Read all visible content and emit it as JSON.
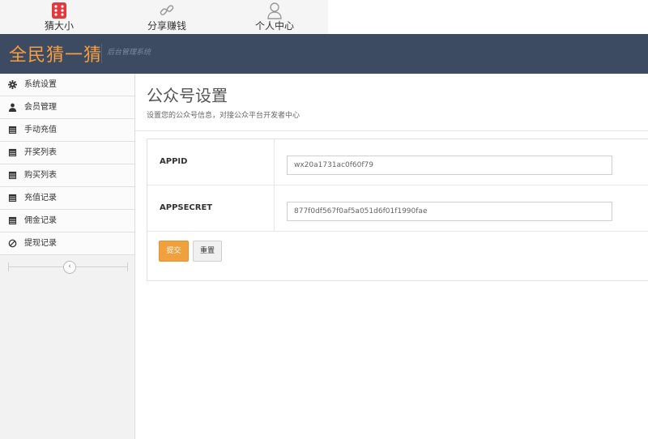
{
  "topnav": {
    "items": [
      {
        "label": "猜大小",
        "icon": "dice-icon"
      },
      {
        "label": "分享赚钱",
        "icon": "link-icon"
      },
      {
        "label": "个人中心",
        "icon": "user-icon"
      }
    ]
  },
  "header": {
    "brand": "全民猜一猜",
    "subtitle": "后台管理系统"
  },
  "sidebar": {
    "items": [
      {
        "label": "系统设置",
        "icon": "gear-icon"
      },
      {
        "label": "会员管理",
        "icon": "user-icon"
      },
      {
        "label": "手动充值",
        "icon": "calendar-icon"
      },
      {
        "label": "开奖列表",
        "icon": "calendar-icon"
      },
      {
        "label": "购买列表",
        "icon": "calendar-icon"
      },
      {
        "label": "充值记录",
        "icon": "calendar-icon"
      },
      {
        "label": "佣金记录",
        "icon": "calendar-icon"
      },
      {
        "label": "提现记录",
        "icon": "ban-icon"
      }
    ],
    "collapse_glyph": "‹"
  },
  "main": {
    "title": "公众号设置",
    "description": "设置您的公众号信息，对接公众平台开发者中心",
    "form": {
      "appid_label": "APPID",
      "appid_value": "wx20a1731ac0f60f79",
      "appsecret_label": "APPSECRET",
      "appsecret_value": "877f0df567f0af5a051d6f01f1990fae",
      "submit_label": "提交",
      "reset_label": "重置"
    }
  },
  "colors": {
    "header_bg": "#3c4a62",
    "brand": "#f59d3f",
    "accent_button": "#f0a13d",
    "dice_red": "#e0393e"
  }
}
